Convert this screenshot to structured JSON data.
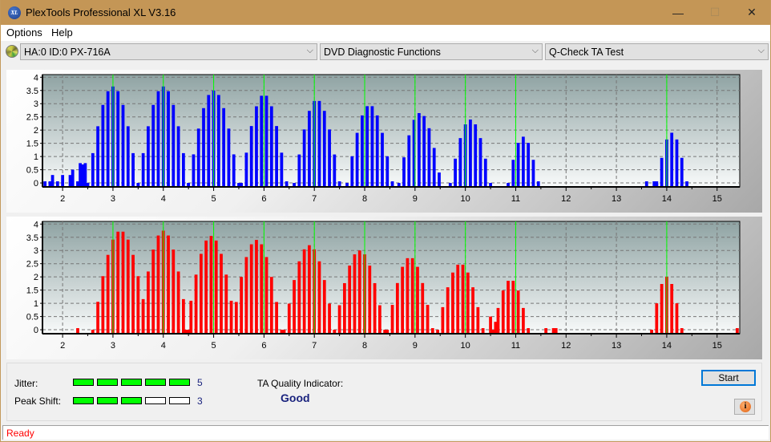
{
  "window": {
    "title": "PlexTools Professional XL V3.16",
    "icon_label": "XL",
    "controls": {
      "minimize": "—",
      "maximize": "☐",
      "close": "✕"
    }
  },
  "menu": [
    "Options",
    "Help"
  ],
  "toolbar": {
    "drive": "HA:0 ID:0  PX-716A",
    "function": "DVD Diagnostic Functions",
    "test": "Q-Check TA Test",
    "chevron": "⌵"
  },
  "colors": {
    "land_bars": "#0000ff",
    "pit_bars": "#ff0000",
    "reference_lines": "#00ff00",
    "meter_on": "#00ff00",
    "quality_text": "#1a237e",
    "status_text": "#ff0000"
  },
  "chart_data": [
    {
      "type": "bar",
      "name": "upper-histogram",
      "title": "",
      "xlabel": "",
      "ylabel": "",
      "xlim": [
        1.6,
        15.45
      ],
      "ylim": [
        -0.15,
        4.1
      ],
      "x_ticks": [
        2,
        3,
        4,
        5,
        6,
        7,
        8,
        9,
        10,
        11,
        12,
        13,
        14,
        15
      ],
      "y_ticks": [
        "0",
        "0.5",
        "1",
        "1.5",
        "2",
        "2.5",
        "3",
        "3.5",
        "4"
      ],
      "reference_lines_x": [
        3,
        4,
        5,
        6,
        7,
        8,
        9,
        10,
        11,
        14
      ],
      "grid": true,
      "color": "#0000ff",
      "peaks": [
        {
          "center": 3.0,
          "height": 3.65,
          "halfwidth": 0.5
        },
        {
          "center": 4.0,
          "height": 3.65,
          "halfwidth": 0.5
        },
        {
          "center": 5.0,
          "height": 3.5,
          "halfwidth": 0.5
        },
        {
          "center": 6.0,
          "height": 3.35,
          "halfwidth": 0.45
        },
        {
          "center": 7.05,
          "height": 3.15,
          "halfwidth": 0.45
        },
        {
          "center": 8.1,
          "height": 2.95,
          "halfwidth": 0.45
        },
        {
          "center": 9.1,
          "height": 2.65,
          "halfwidth": 0.42
        },
        {
          "center": 10.1,
          "height": 2.4,
          "halfwidth": 0.4
        },
        {
          "center": 11.15,
          "height": 1.75,
          "halfwidth": 0.3
        },
        {
          "center": 14.1,
          "height": 1.9,
          "halfwidth": 0.3
        }
      ],
      "extra_bars": [
        {
          "x": 1.65,
          "y": 0.0
        },
        {
          "x": 1.75,
          "y": 0.0
        },
        {
          "x": 1.8,
          "y": 0.3
        },
        {
          "x": 1.9,
          "y": 0.0
        },
        {
          "x": 2.0,
          "y": 0.3
        },
        {
          "x": 2.15,
          "y": 0.3
        },
        {
          "x": 2.2,
          "y": 0.5
        },
        {
          "x": 2.3,
          "y": 0.0
        },
        {
          "x": 2.35,
          "y": 0.75
        },
        {
          "x": 2.4,
          "y": 0.7
        },
        {
          "x": 2.45,
          "y": 0.75
        },
        {
          "x": 13.6,
          "y": 0.0
        },
        {
          "x": 13.75,
          "y": 0.0
        },
        {
          "x": 13.8,
          "y": 0.0
        }
      ]
    },
    {
      "type": "bar",
      "name": "lower-histogram",
      "title": "",
      "xlabel": "",
      "ylabel": "",
      "xlim": [
        1.6,
        15.45
      ],
      "ylim": [
        -0.15,
        4.1
      ],
      "x_ticks": [
        2,
        3,
        4,
        5,
        6,
        7,
        8,
        9,
        10,
        11,
        12,
        13,
        14,
        15
      ],
      "y_ticks": [
        "0",
        "0.5",
        "1",
        "1.5",
        "2",
        "2.5",
        "3",
        "3.5",
        "4"
      ],
      "reference_lines_x": [
        3,
        4,
        5,
        6,
        7,
        8,
        9,
        10,
        11,
        14
      ],
      "grid": true,
      "color": "#ff0000",
      "peaks": [
        {
          "center": 3.15,
          "height": 3.75,
          "halfwidth": 0.55
        },
        {
          "center": 4.0,
          "height": 3.75,
          "halfwidth": 0.5
        },
        {
          "center": 4.95,
          "height": 3.55,
          "halfwidth": 0.5
        },
        {
          "center": 5.85,
          "height": 3.4,
          "halfwidth": 0.5
        },
        {
          "center": 6.9,
          "height": 3.2,
          "halfwidth": 0.5
        },
        {
          "center": 7.9,
          "height": 3.0,
          "halfwidth": 0.5
        },
        {
          "center": 8.9,
          "height": 2.75,
          "halfwidth": 0.45
        },
        {
          "center": 9.9,
          "height": 2.5,
          "halfwidth": 0.45
        },
        {
          "center": 10.9,
          "height": 1.9,
          "halfwidth": 0.35
        },
        {
          "center": 14.0,
          "height": 2.0,
          "halfwidth": 0.3
        }
      ],
      "extra_bars": [
        {
          "x": 2.3,
          "y": 0.0
        },
        {
          "x": 11.6,
          "y": 0.0
        },
        {
          "x": 11.75,
          "y": 0.0
        },
        {
          "x": 11.8,
          "y": 0.0
        },
        {
          "x": 15.4,
          "y": 0.0
        },
        {
          "x": 10.5,
          "y": 0.5
        },
        {
          "x": 10.6,
          "y": 0.3
        }
      ]
    }
  ],
  "metrics": {
    "jitter": {
      "label": "Jitter:",
      "value": "5",
      "filled": 5,
      "total": 5
    },
    "peak_shift": {
      "label": "Peak Shift:",
      "value": "3",
      "filled": 3,
      "total": 5
    },
    "ta_quality_label": "TA Quality Indicator:",
    "ta_quality_value": "Good"
  },
  "buttons": {
    "start": "Start",
    "info": "i"
  },
  "status": "Ready"
}
